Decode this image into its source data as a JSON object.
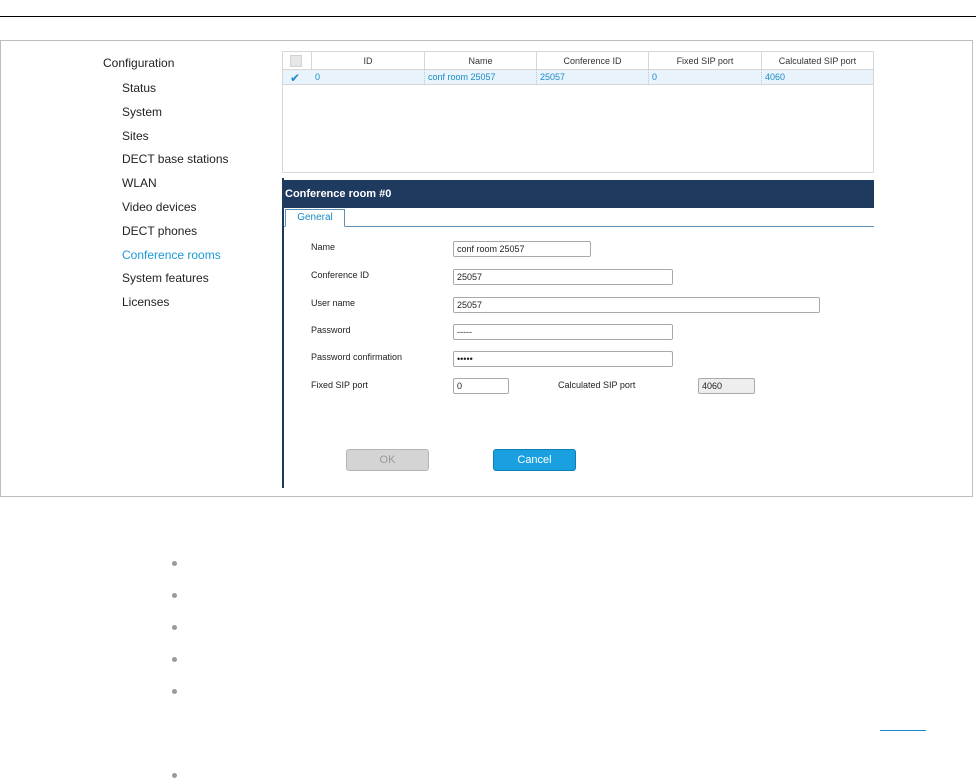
{
  "sidebar": {
    "root": "Configuration",
    "items": [
      {
        "label": "Status"
      },
      {
        "label": "System"
      },
      {
        "label": "Sites"
      },
      {
        "label": "DECT base stations"
      },
      {
        "label": "WLAN"
      },
      {
        "label": "Video devices"
      },
      {
        "label": "DECT phones"
      },
      {
        "label": "Conference rooms",
        "active": true
      },
      {
        "label": "System features"
      },
      {
        "label": "Licenses"
      }
    ]
  },
  "grid": {
    "columns": [
      "ID",
      "Name",
      "Conference ID",
      "Fixed SIP port",
      "Calculated SIP port"
    ],
    "rows": [
      {
        "selected": true,
        "cells": [
          "0",
          "conf room 25057",
          "25057",
          "0",
          "4060"
        ]
      }
    ]
  },
  "panel": {
    "title": "Conference room #0",
    "tab": "General",
    "fields": {
      "name_label": "Name",
      "name_value": "conf room 25057",
      "conf_id_label": "Conference ID",
      "conf_id_value": "25057",
      "user_name_label": "User name",
      "user_name_value": "25057",
      "password_label": "Password",
      "password_value": "-----",
      "password_conf_label": "Password confirmation",
      "password_conf_value": "•••••",
      "fixed_sip_label": "Fixed SIP port",
      "fixed_sip_value": "0",
      "calc_sip_label": "Calculated SIP port",
      "calc_sip_value": "4060"
    },
    "buttons": {
      "ok": "OK",
      "cancel": "Cancel"
    }
  },
  "colors": {
    "accent": "#1a9ad6",
    "header": "#1f3a5f",
    "cancel": "#1aa0e0"
  }
}
